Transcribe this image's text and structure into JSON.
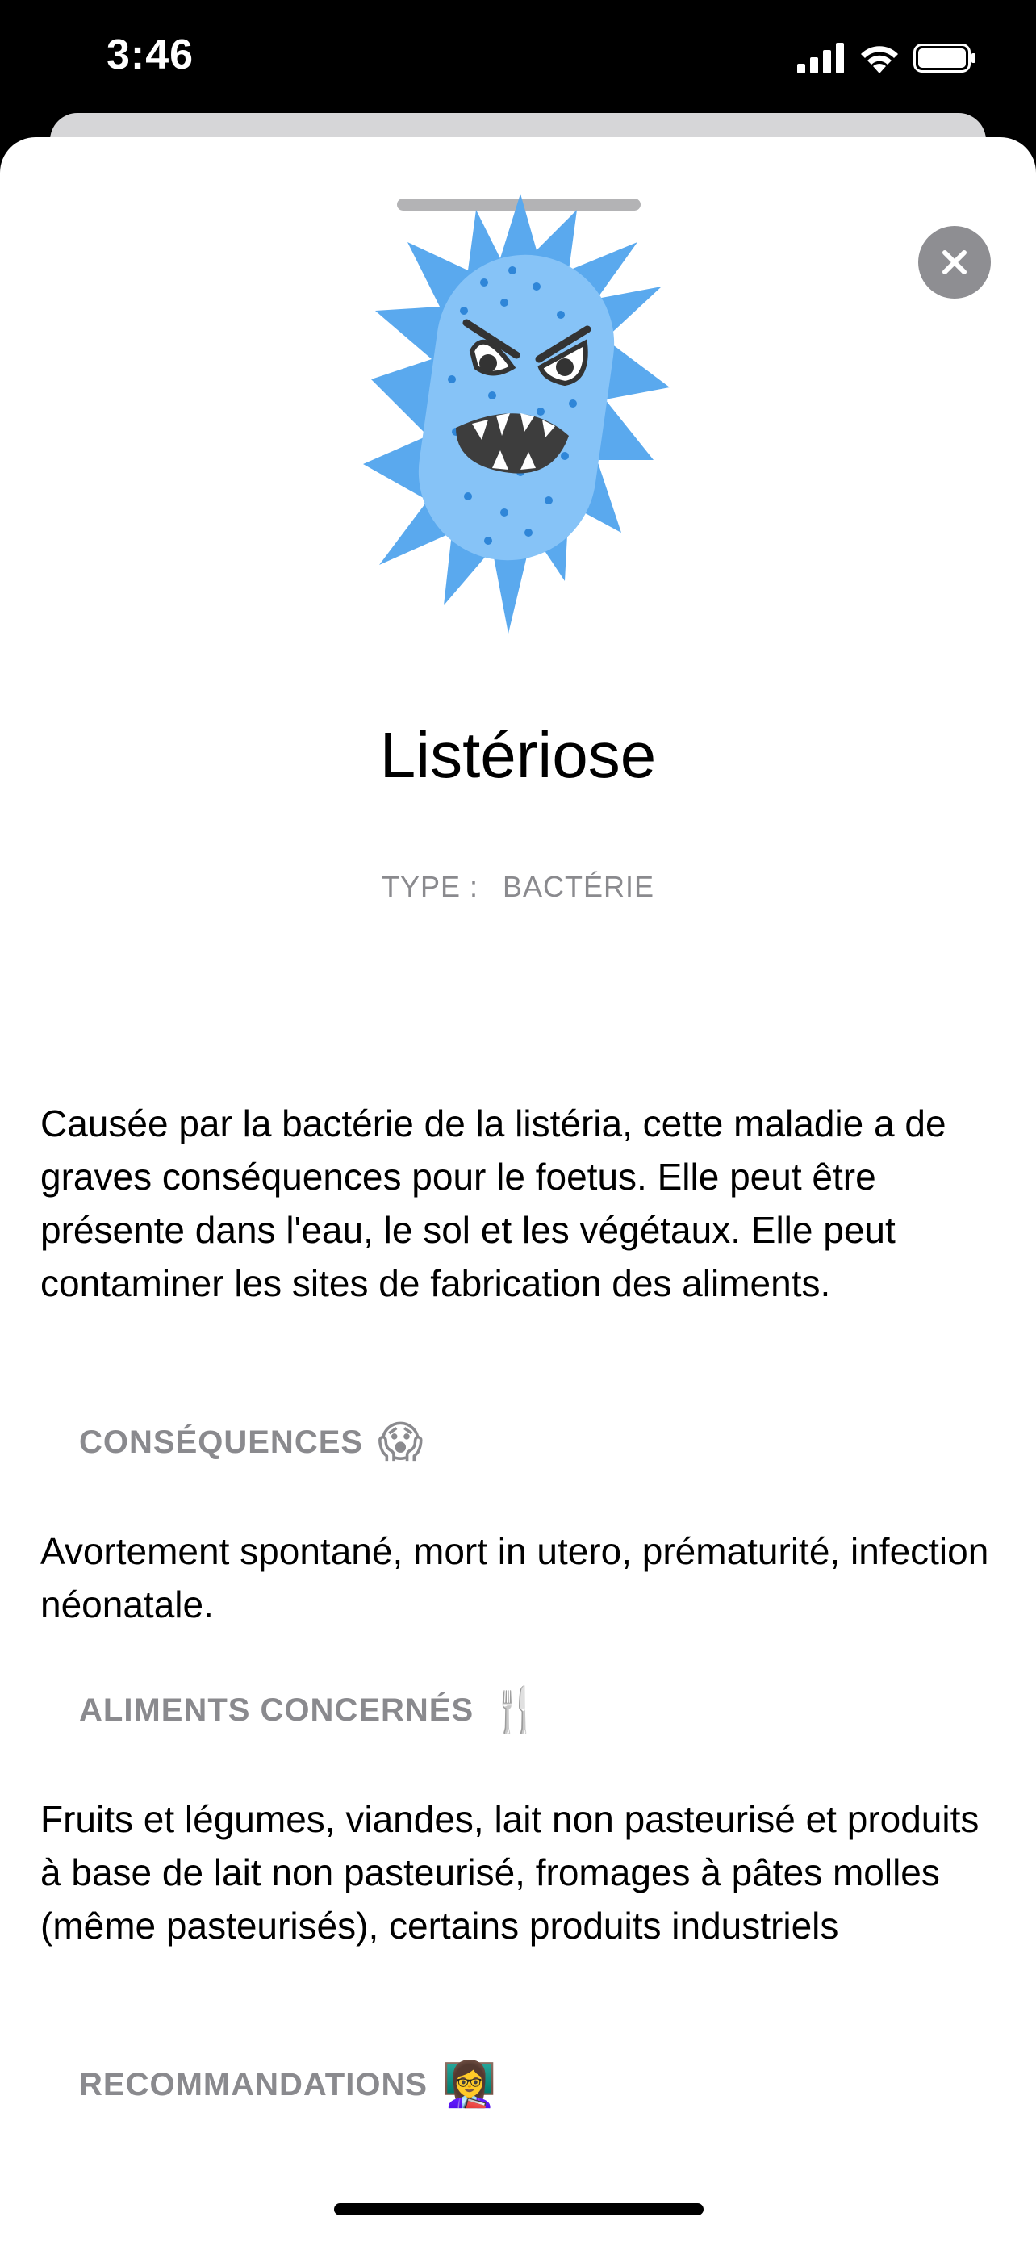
{
  "status_bar": {
    "time": "3:46",
    "icons": [
      "cellular-signal-icon",
      "wifi-icon",
      "battery-icon"
    ]
  },
  "sheet": {
    "close_icon": "close-icon",
    "illustration": "angry-bacterium-illustration"
  },
  "disease": {
    "title": "Listériose",
    "type_label": "TYPE :",
    "type_value": "BACTÉRIE",
    "description": "Causée par la bactérie de la listéria, cette maladie a de graves conséquences pour le foetus. Elle peut être présente dans l'eau, le sol et les végétaux. Elle peut contaminer les sites de fabrication des aliments."
  },
  "sections": {
    "consequences": {
      "title": "CONSÉQUENCES",
      "emoji": "😱",
      "text": "Avortement spontané, mort in utero, prématurité, infection néonatale."
    },
    "foods": {
      "title": "ALIMENTS CONCERNÉS",
      "emoji": "🍴",
      "text": "Fruits et légumes, viandes, lait non pasteurisé et produits à base de lait non pasteurisé, fromages à pâtes molles (même pasteurisés), certains produits industriels"
    },
    "recommendations": {
      "title": "RECOMMANDATIONS",
      "emoji": "👩‍🏫"
    }
  },
  "colors": {
    "background": "#000000",
    "sheet": "#ffffff",
    "secondary_text": "#8a8a8e",
    "close_button": "#8e8e92",
    "bacterium_outer": "#5aa9ee",
    "bacterium_inner": "#86c3f7"
  }
}
